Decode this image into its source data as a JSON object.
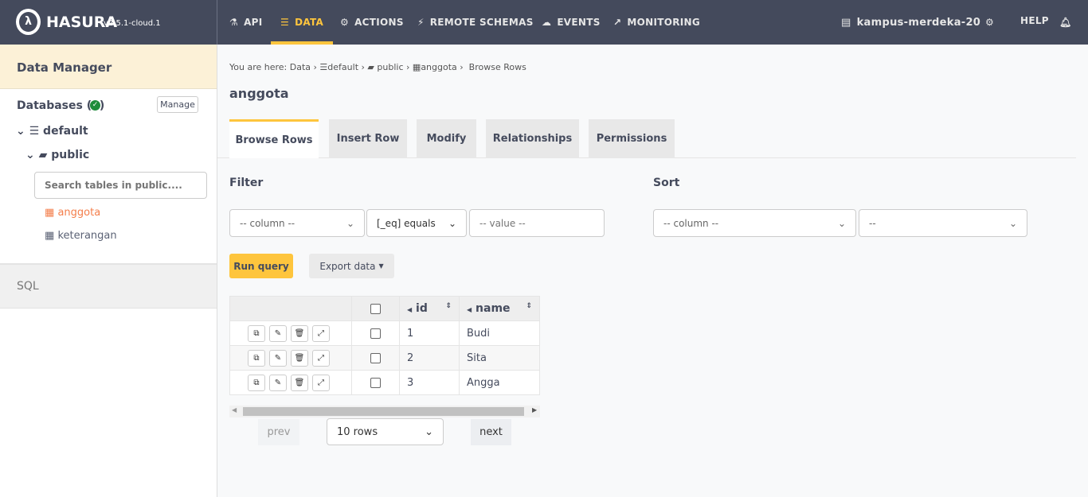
{
  "header": {
    "brand": "HASURA",
    "version": "v2.5.1-cloud.1",
    "nav": [
      {
        "label": "API",
        "icon": "flask-icon"
      },
      {
        "label": "DATA",
        "icon": "database-icon"
      },
      {
        "label": "ACTIONS",
        "icon": "cogs-icon"
      },
      {
        "label": "REMOTE SCHEMAS",
        "icon": "plug-icon"
      },
      {
        "label": "EVENTS",
        "icon": "cloud-icon"
      },
      {
        "label": "MONITORING",
        "icon": "chart-icon"
      }
    ],
    "project": "kampus-merdeka-20",
    "help": "HELP"
  },
  "sidebar": {
    "title": "Data Manager",
    "databases": "Databases (1)",
    "manage": "Manage",
    "db": "default",
    "schema": "public",
    "search_placeholder": "Search tables in public....",
    "tables": [
      "anggota",
      "keterangan"
    ],
    "sql": "SQL"
  },
  "breadcrumb": {
    "prefix": "You are here:",
    "items": [
      "Data",
      "default",
      "public",
      "anggota",
      "Browse Rows"
    ]
  },
  "page_title": "anggota",
  "tabs": [
    "Browse Rows",
    "Insert Row",
    "Modify",
    "Relationships",
    "Permissions"
  ],
  "filter": {
    "label": "Filter",
    "column": "-- column --",
    "operator": "[_eq] equals",
    "value_placeholder": "-- value --"
  },
  "sort": {
    "label": "Sort",
    "column": "-- column --",
    "order": "--"
  },
  "run_query": "Run query",
  "export": "Export data",
  "table": {
    "columns": [
      "id",
      "name"
    ],
    "rows": [
      [
        "1",
        "Budi"
      ],
      [
        "2",
        "Sita"
      ],
      [
        "3",
        "Angga"
      ]
    ]
  },
  "pagination": {
    "prev": "prev",
    "rows": "10 rows",
    "next": "next"
  },
  "colors": {
    "accent": "#fec53d",
    "header": "#444a5c",
    "active_table": "#f47e4b"
  }
}
